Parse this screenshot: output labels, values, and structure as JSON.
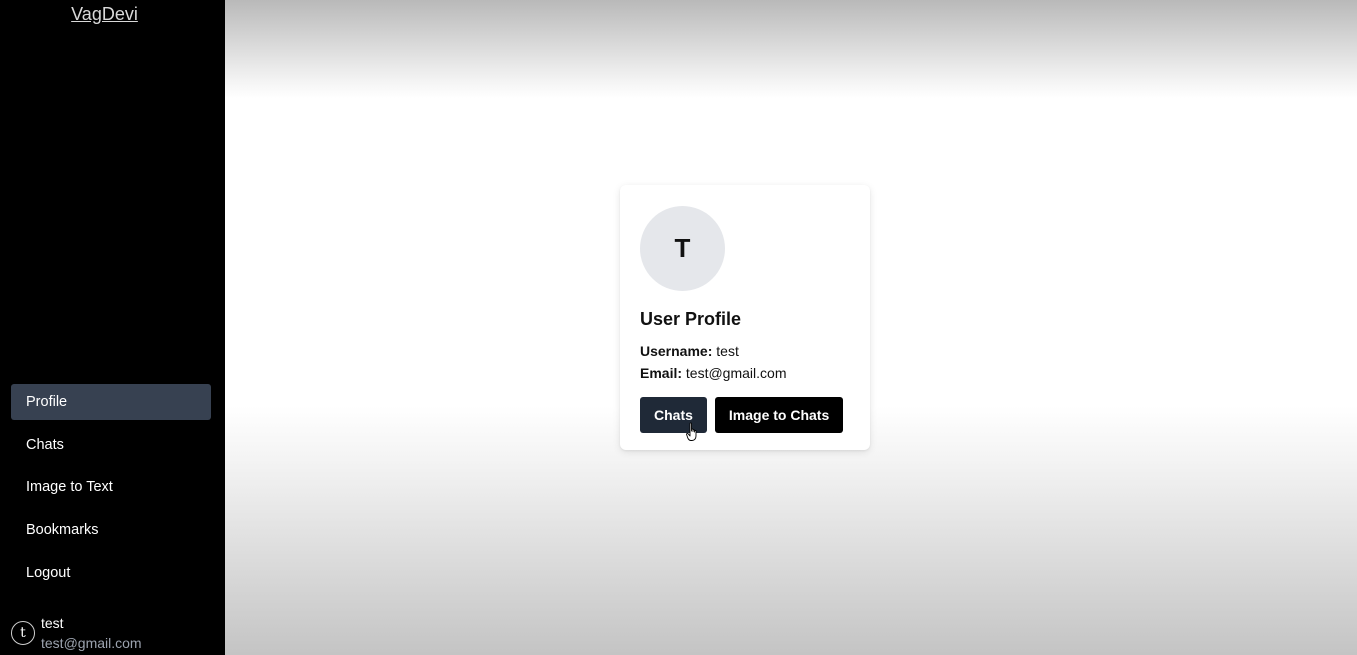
{
  "sidebar": {
    "brand": "VagDevi",
    "items": [
      {
        "label": "Profile",
        "active": true
      },
      {
        "label": "Chats",
        "active": false
      },
      {
        "label": "Image to Text",
        "active": false
      },
      {
        "label": "Bookmarks",
        "active": false
      },
      {
        "label": "Logout",
        "active": false
      }
    ],
    "user": {
      "avatar_letter": "t",
      "name": "test",
      "email": "test@gmail.com"
    }
  },
  "profile": {
    "avatar_letter": "T",
    "title": "User Profile",
    "username_label": "Username:",
    "username": "test",
    "email_label": "Email:",
    "email": "test@gmail.com",
    "chats_button": "Chats",
    "image_button": "Image to Chats"
  },
  "colors": {
    "sidebar_bg": "#000000",
    "active_item_bg": "#374151",
    "chats_button_bg": "#1f2937",
    "image_button_bg": "#000000"
  }
}
